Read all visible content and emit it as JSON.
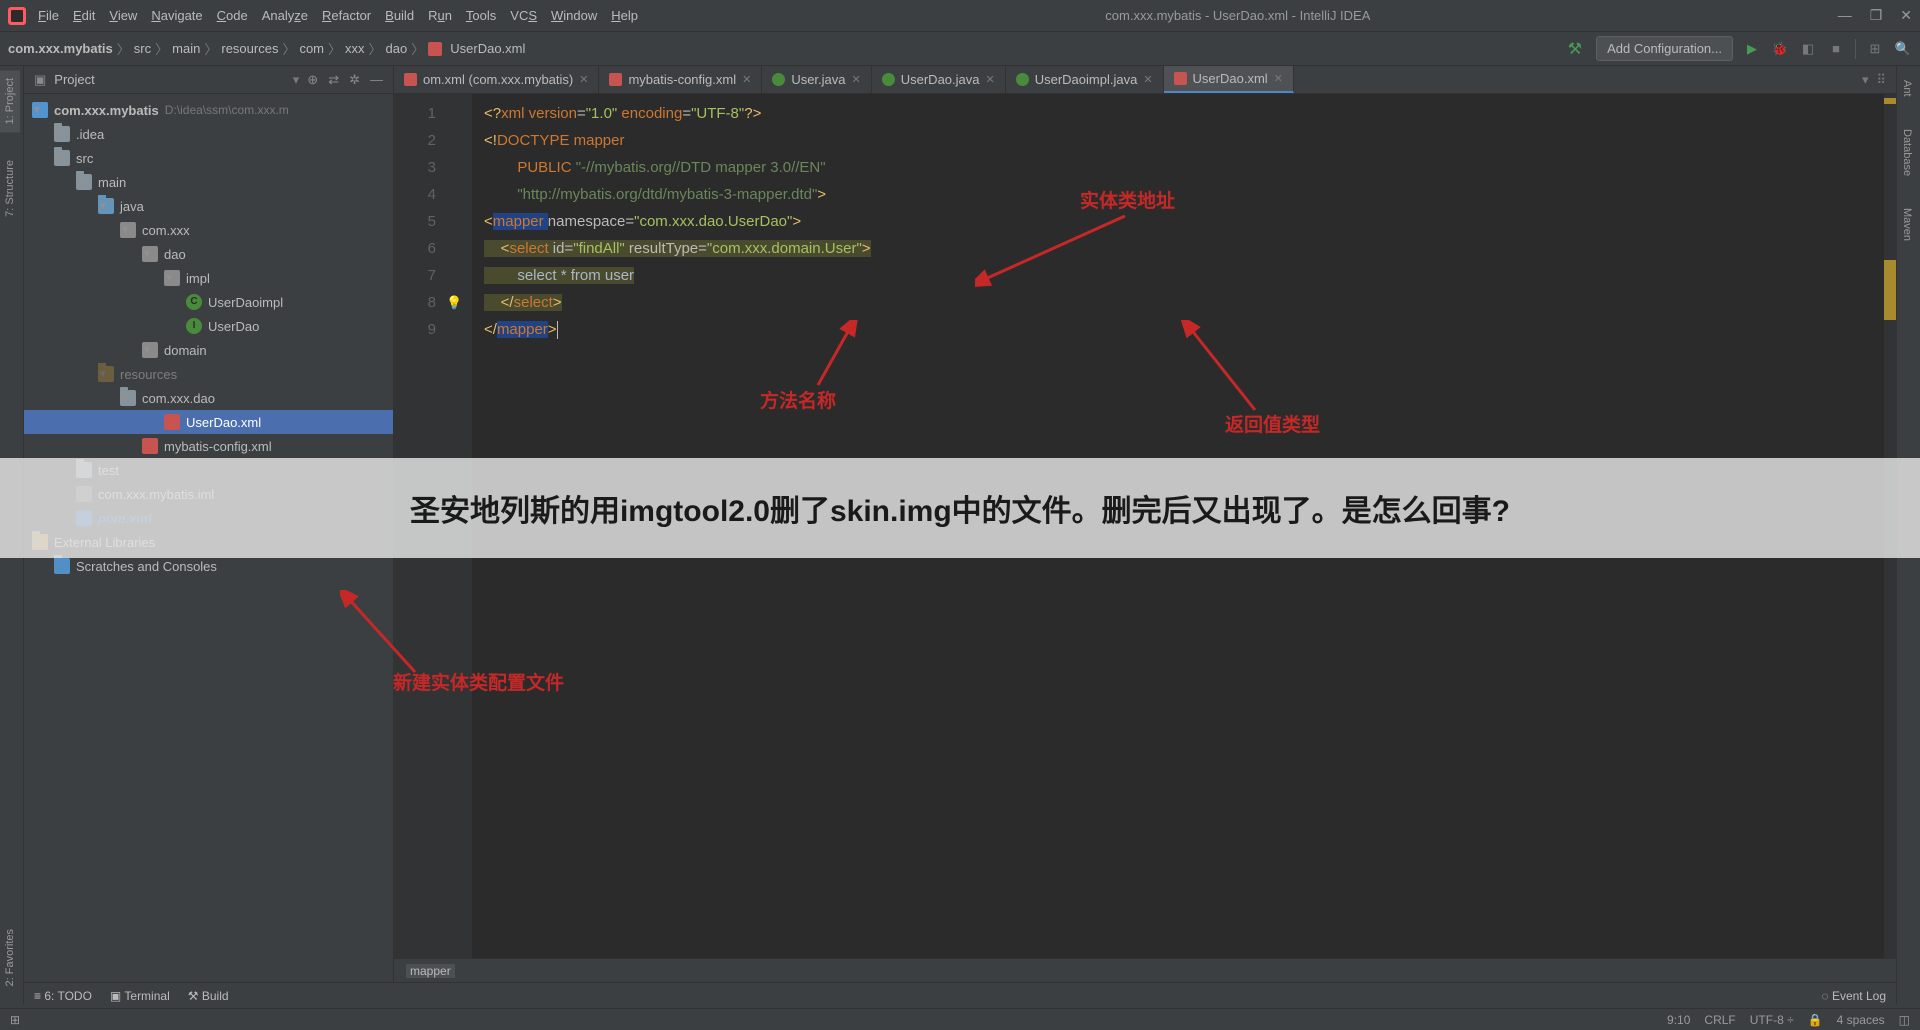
{
  "window": {
    "title": "com.xxx.mybatis - UserDao.xml - IntelliJ IDEA"
  },
  "menu": {
    "items": [
      "File",
      "Edit",
      "View",
      "Navigate",
      "Code",
      "Analyze",
      "Refactor",
      "Build",
      "Run",
      "Tools",
      "VCS",
      "Window",
      "Help"
    ]
  },
  "breadcrumb": {
    "items": [
      "com.xxx.mybatis",
      "src",
      "main",
      "resources",
      "com",
      "xxx",
      "dao",
      "UserDao.xml"
    ]
  },
  "run_config": {
    "label": "Add Configuration..."
  },
  "left_rail": {
    "project": "1: Project",
    "structure": "7: Structure",
    "favorites": "2: Favorites"
  },
  "right_rail": {
    "ant": "Ant",
    "database": "Database",
    "maven": "Maven"
  },
  "project_panel": {
    "title": "Project"
  },
  "tree": {
    "root": "com.xxx.mybatis",
    "root_hint": "D:\\idea\\ssm\\com.xxx.m",
    "idea": ".idea",
    "src": "src",
    "main": "main",
    "java": "java",
    "pkg_com_xxx": "com.xxx",
    "pkg_dao": "dao",
    "pkg_impl": "impl",
    "userdaoimpl": "UserDaoimpl",
    "userdao": "UserDao",
    "pkg_domain": "domain",
    "resources": "resources",
    "pkg_res_dao": "com.xxx.dao",
    "userdao_xml": "UserDao.xml",
    "mybatis_config": "mybatis-config.xml",
    "test": "test",
    "iml": "com.xxx.mybatis.iml",
    "pom": "pom.xml",
    "ext_libs": "External Libraries",
    "scratches": "Scratches and Consoles"
  },
  "tabs": [
    {
      "label": "om.xml (com.xxx.mybatis)",
      "icon": "xml"
    },
    {
      "label": "mybatis-config.xml",
      "icon": "xml"
    },
    {
      "label": "User.java",
      "icon": "java"
    },
    {
      "label": "UserDao.java",
      "icon": "java"
    },
    {
      "label": "UserDaoimpl.java",
      "icon": "java"
    },
    {
      "label": "UserDao.xml",
      "icon": "xml",
      "active": true
    }
  ],
  "gutter_lines": [
    "1",
    "2",
    "3",
    "4",
    "5",
    "6",
    "7",
    "8",
    "9"
  ],
  "code_tokens": {
    "l1_a": "<?",
    "l1_b": "xml version",
    "l1_c": "=",
    "l1_d": "\"1.0\"",
    "l1_e": " encoding",
    "l1_f": "=",
    "l1_g": "\"UTF-8\"",
    "l1_h": "?>",
    "l2_a": "<!",
    "l2_b": "DOCTYPE mapper",
    "l3_a": "        PUBLIC ",
    "l3_b": "\"-//mybatis.org//DTD mapper 3.0//EN\"",
    "l4_a": "        ",
    "l4_b": "\"http://mybatis.org/dtd/mybatis-3-mapper.dtd\"",
    "l4_c": ">",
    "l5_a": "<",
    "l5_b": "mapper ",
    "l5_c": "namespace",
    "l5_d": "=",
    "l5_e": "\"com.xxx.dao.UserDao\"",
    "l5_f": ">",
    "l6_a": "    <",
    "l6_b": "select ",
    "l6_c": "id",
    "l6_d": "=",
    "l6_e": "\"findAll\"",
    "l6_f": " resultType",
    "l6_g": "=",
    "l6_h": "\"com.xxx.domain.User\"",
    "l6_i": ">",
    "l7_a": "        select * from user",
    "l8_a": "    </",
    "l8_b": "select",
    "l8_c": ">",
    "l9_a": "</",
    "l9_b": "mapper",
    "l9_c": ">"
  },
  "editor_breadcrumb": "mapper",
  "annotations": {
    "entity_addr": "实体类地址",
    "method_name": "方法名称",
    "return_type": "返回值类型",
    "new_file": "新建实体类配置文件"
  },
  "banner": "圣安地列斯的用imgtool2.0删了skin.img中的文件。删完后又出现了。是怎么回事?",
  "bottom_tools": {
    "todo": "6: TODO",
    "terminal": "Terminal",
    "build": "Build",
    "event_log": "Event Log"
  },
  "statusbar": {
    "pos": "9:10",
    "eol": "CRLF",
    "encoding": "UTF-8",
    "indent": "4 spaces"
  }
}
